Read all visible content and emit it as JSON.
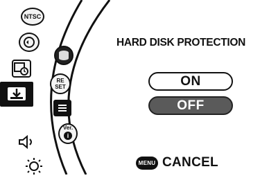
{
  "screen_title": "HARD DISK PROTECTION",
  "options": [
    {
      "label": "ON",
      "selected": false
    },
    {
      "label": "OFF",
      "selected": true
    }
  ],
  "footer": {
    "button_label": "MENU",
    "action_label": "CANCEL"
  },
  "left_column": {
    "items": [
      {
        "label": "NTSC",
        "icon": "ntsc-icon"
      },
      {
        "label": "",
        "icon": "wave-settings-icon"
      },
      {
        "label": "",
        "icon": "clock-settings-icon"
      },
      {
        "label": "",
        "icon": "disk-save-icon",
        "selected": true
      },
      {
        "label": "",
        "icon": "speaker-icon"
      },
      {
        "label": "",
        "icon": "brightness-icon"
      }
    ]
  },
  "submenu": {
    "items": [
      {
        "label": "",
        "icon": "hard-disk-icon"
      },
      {
        "label": "RE SET",
        "icon": "reset-icon"
      },
      {
        "label": "",
        "icon": "list-icon"
      },
      {
        "label": "Ver.",
        "icon": "version-info-icon"
      }
    ]
  },
  "colors": {
    "background": "#ffffff",
    "ink": "#111111",
    "selected_fill": "#5a5a5a"
  }
}
